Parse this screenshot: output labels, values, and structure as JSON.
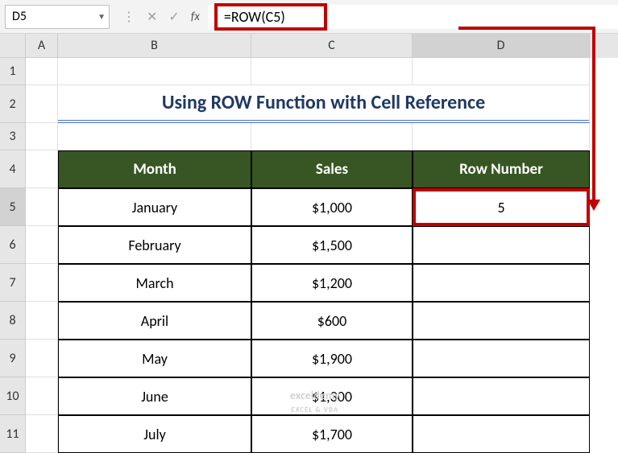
{
  "nameBox": "D5",
  "formula": "=ROW(C5)",
  "columns": [
    "A",
    "B",
    "C",
    "D"
  ],
  "rows": [
    "1",
    "2",
    "3",
    "4",
    "5",
    "6",
    "7",
    "8",
    "9",
    "10",
    "11"
  ],
  "title": "Using ROW Function with Cell Reference",
  "headers": {
    "month": "Month",
    "sales": "Sales",
    "rowNumber": "Row Number"
  },
  "data": [
    {
      "month": "January",
      "sales": "$1,000",
      "rowNumber": "5"
    },
    {
      "month": "February",
      "sales": "$1,500",
      "rowNumber": ""
    },
    {
      "month": "March",
      "sales": "$1,200",
      "rowNumber": ""
    },
    {
      "month": "April",
      "sales": "$600",
      "rowNumber": ""
    },
    {
      "month": "May",
      "sales": "$1,900",
      "rowNumber": ""
    },
    {
      "month": "June",
      "sales": "$1,300",
      "rowNumber": ""
    },
    {
      "month": "July",
      "sales": "$1,700",
      "rowNumber": ""
    }
  ],
  "watermark": {
    "main": "exceldemy",
    "sub": "EXCEL & VBA"
  }
}
